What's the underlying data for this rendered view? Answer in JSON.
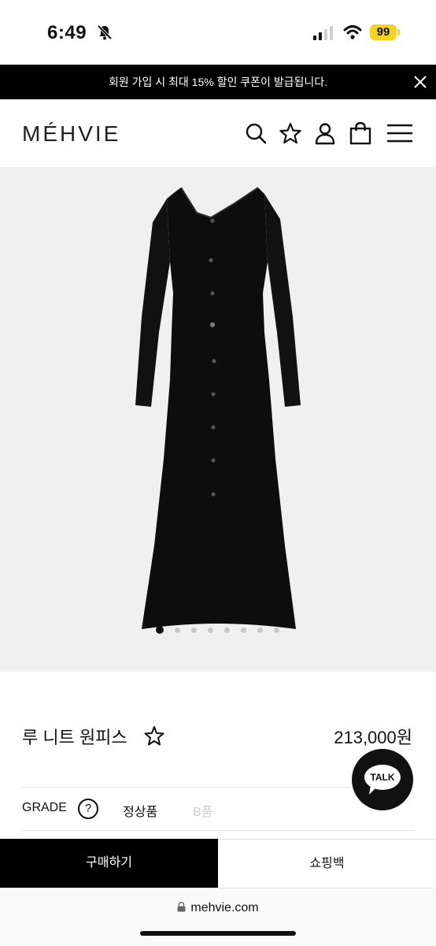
{
  "status_bar": {
    "time": "6:49",
    "battery": "99"
  },
  "banner": {
    "text": "회원 가입 시 최대 15% 할인 쿠폰이 발급됩니다."
  },
  "header": {
    "logo": "MÉHVIE"
  },
  "gallery": {
    "image_count": 8,
    "active_index": 0
  },
  "product": {
    "name": "루 니트 원피스",
    "price": "213,000원"
  },
  "grade": {
    "label": "GRADE",
    "help": "?",
    "options": [
      "정상품",
      "B품"
    ]
  },
  "chat": {
    "label": "TALK"
  },
  "actions": {
    "buy": "구매하기",
    "bag": "쇼핑백"
  },
  "browser": {
    "url": "mehvie.com"
  }
}
